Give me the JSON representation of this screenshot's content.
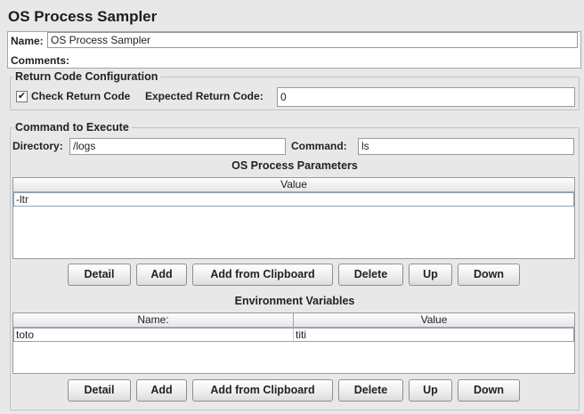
{
  "window": {
    "title": "OS Process Sampler"
  },
  "name_field": {
    "label": "Name:",
    "value": "OS Process Sampler"
  },
  "comments": {
    "label": "Comments:"
  },
  "return_code": {
    "legend": "Return Code Configuration",
    "check_label": "Check Return Code",
    "checked": true,
    "checkmark": "✔",
    "expected_label": "Expected Return Code:",
    "expected_value": "0"
  },
  "command": {
    "legend": "Command to Execute",
    "directory_label": "Directory:",
    "directory_value": "/logs",
    "command_label": "Command:",
    "command_value": "ls"
  },
  "params": {
    "title": "OS Process Parameters",
    "columns": [
      "Value"
    ],
    "rows": [
      [
        "-ltr"
      ]
    ],
    "buttons": [
      "Detail",
      "Add",
      "Add from Clipboard",
      "Delete",
      "Up",
      "Down"
    ]
  },
  "env": {
    "title": "Environment Variables",
    "columns": [
      "Name:",
      "Value"
    ],
    "rows": [
      [
        "toto",
        "titi"
      ]
    ],
    "buttons": [
      "Detail",
      "Add",
      "Add from Clipboard",
      "Delete",
      "Up",
      "Down"
    ]
  }
}
